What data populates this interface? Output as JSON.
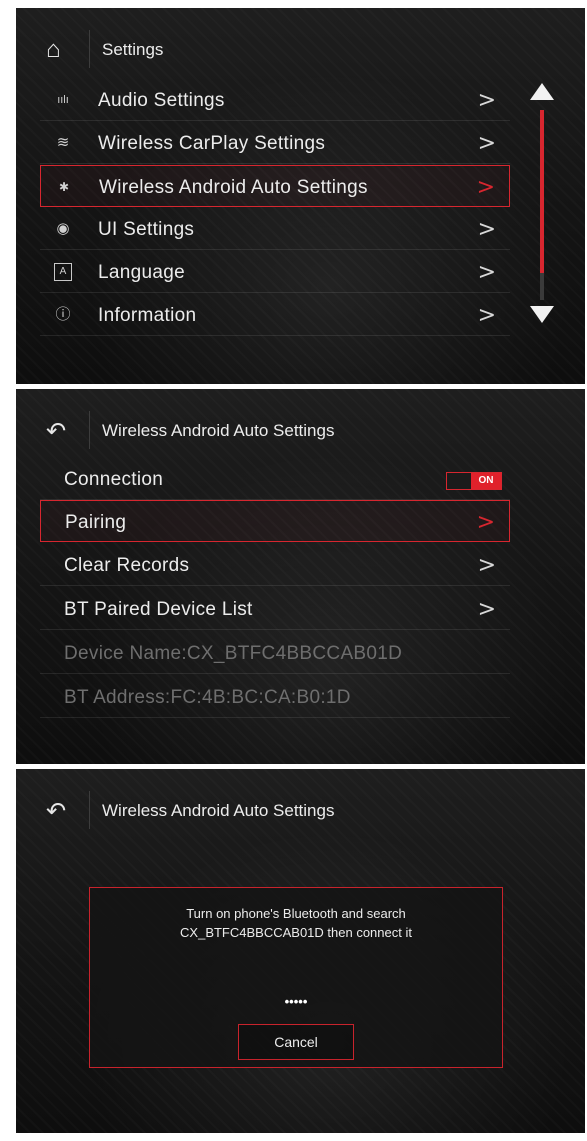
{
  "settings_screen": {
    "title": "Settings",
    "items": [
      {
        "icon": "audio-icon",
        "glyph": "ıılı",
        "label": "Audio Settings"
      },
      {
        "icon": "wifi-icon",
        "glyph": "≋",
        "label": "Wireless CarPlay Settings"
      },
      {
        "icon": "bluetooth-icon",
        "glyph": "✱",
        "label": "Wireless Android Auto Settings",
        "selected": true
      },
      {
        "icon": "palette-icon",
        "glyph": "◉",
        "label": "UI Settings"
      },
      {
        "icon": "language-icon",
        "glyph": "A",
        "label": "Language"
      },
      {
        "icon": "info-icon",
        "glyph": "ⓘ",
        "label": "Information"
      }
    ]
  },
  "android_auto_screen": {
    "title": "Wireless Android Auto Settings",
    "connection_label": "Connection",
    "toggle_text": "ON",
    "pairing_label": "Pairing",
    "clear_records_label": "Clear Records",
    "bt_paired_label": "BT Paired Device List",
    "device_name": "Device Name:CX_BTFC4BBCCAB01D",
    "bt_address": "BT Address:FC:4B:BC:CA:B0:1D"
  },
  "pairing_dialog_screen": {
    "title": "Wireless Android Auto Settings",
    "message_line1": "Turn on phone's Bluetooth and search",
    "message_line2": "CX_BTFC4BBCCAB01D then connect it",
    "progress": "•••••",
    "cancel_label": "Cancel"
  },
  "colors": {
    "accent": "#d7262f",
    "background": "#161616",
    "text": "#ececec",
    "dim_text": "#6e6e6e"
  }
}
